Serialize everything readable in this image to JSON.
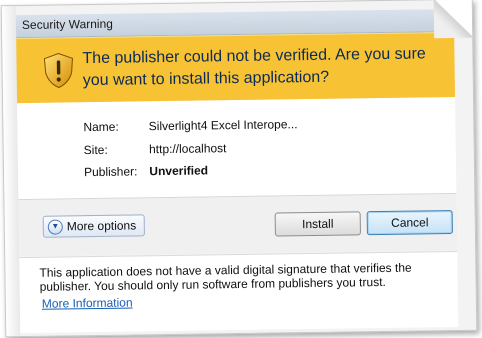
{
  "window": {
    "title": "Security Warning"
  },
  "banner": {
    "headline": "The publisher could not be verified. Are you sure you want to install this application?",
    "icon": "warning-shield-icon",
    "color": "#f7c233"
  },
  "details": {
    "name_label": "Name:",
    "name_value": "Silverlight4 Excel Interope...",
    "site_label": "Site:",
    "site_value": "http://localhost",
    "publisher_label": "Publisher:",
    "publisher_value": "Unverified"
  },
  "actions": {
    "more_options_label": "More options",
    "install_label": "Install",
    "cancel_label": "Cancel"
  },
  "footer": {
    "text": "This application does not have a valid digital signature that verifies the publisher. You should only run software from publishers you trust.",
    "link_label": "More Information"
  }
}
